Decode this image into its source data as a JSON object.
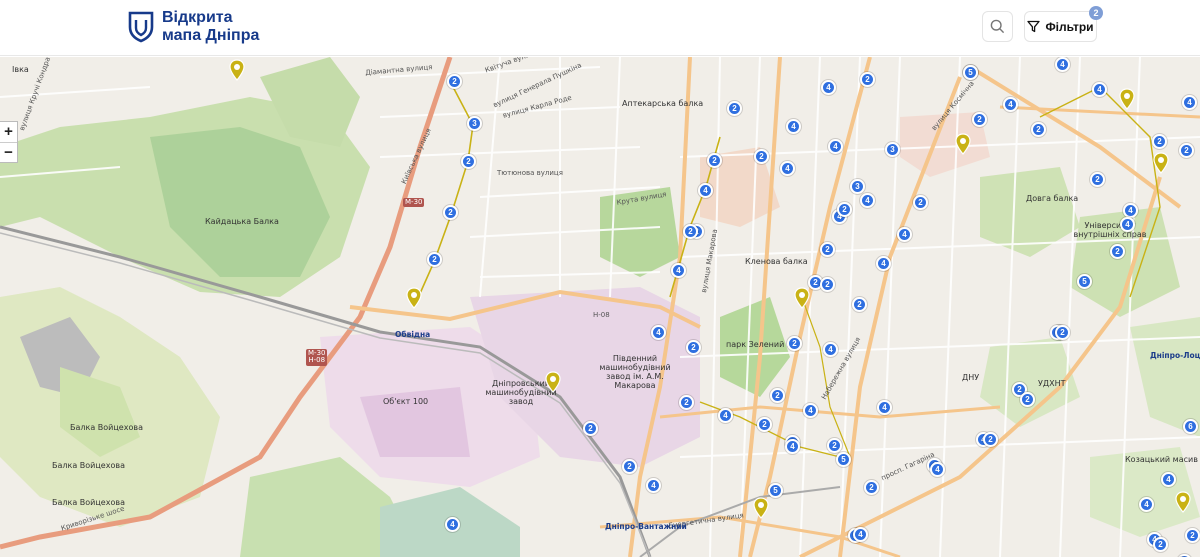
{
  "header": {
    "logo_line1": "Відкрита",
    "logo_line2": "мапа Дніпра",
    "filter_label": "Фільтри",
    "filter_count": "2",
    "accent_color": "#173a8a"
  },
  "zoom": {
    "plus": "+",
    "minus": "−"
  },
  "map_labels": [
    {
      "name": "label-ivka",
      "text": "Івка",
      "cls": ""
    },
    {
      "name": "label-kryvyi-kut",
      "text": "вулиця Кручі Кондратюка",
      "cls": "road"
    },
    {
      "name": "label-diamantna",
      "text": "Діамантна вулиця",
      "cls": "road"
    },
    {
      "name": "label-kvituchasta",
      "text": "Квітуча вулиця",
      "cls": "road"
    },
    {
      "name": "label-karla-rode",
      "text": "вулиця Карла Роде",
      "cls": "road"
    },
    {
      "name": "label-heneral",
      "text": "вулиця Генерала Пушкіна",
      "cls": "road"
    },
    {
      "name": "label-aptekarska",
      "text": "Аптекарська балка",
      "cls": ""
    },
    {
      "name": "label-tiutiunova",
      "text": "Тютюнова вулиця",
      "cls": "road"
    },
    {
      "name": "label-kruta",
      "text": "Крута вулиця",
      "cls": "road"
    },
    {
      "name": "label-kaidatska",
      "text": "Кайдацька Балка",
      "cls": ""
    },
    {
      "name": "label-kyivska",
      "text": "Київська вулиця",
      "cls": "road"
    },
    {
      "name": "label-obidka",
      "text": "Обвідна",
      "cls": "city"
    },
    {
      "name": "label-pivdennyi",
      "text": "Південний машинобудівний завод ім. А.М. Макарова",
      "cls": ""
    },
    {
      "name": "label-dnipro-zavod",
      "text": "Дніпровський машинобудівний завод",
      "cls": ""
    },
    {
      "name": "label-obiekt",
      "text": "Об'єкт 100",
      "cls": ""
    },
    {
      "name": "label-park",
      "text": "парк Зелений Гай",
      "cls": ""
    },
    {
      "name": "label-klenova",
      "text": "Кленова балка",
      "cls": ""
    },
    {
      "name": "label-balka-voitsekhova-1",
      "text": "Балка Войцехова",
      "cls": ""
    },
    {
      "name": "label-balka-voitsekhova-2",
      "text": "Балка Войцехова",
      "cls": ""
    },
    {
      "name": "label-balka-voitsekhova-3",
      "text": "Балка Войцехова",
      "cls": ""
    },
    {
      "name": "label-kryvorizke",
      "text": "Криворізьке шосе",
      "cls": "road"
    },
    {
      "name": "label-energetychna",
      "text": "Енергетична вулиця",
      "cls": "road"
    },
    {
      "name": "label-dnipro-vantazhnyi",
      "text": "Дніпро-Вантажний",
      "cls": "city"
    },
    {
      "name": "label-dnipro-lotsmanska",
      "text": "Дніпро-Лоцманська",
      "cls": "city"
    },
    {
      "name": "label-universytet",
      "text": "Університет внутрішніх справ",
      "cls": ""
    },
    {
      "name": "label-dovha-balka",
      "text": "Довга балка",
      "cls": ""
    },
    {
      "name": "label-udhnt",
      "text": "УДХНТ",
      "cls": ""
    },
    {
      "name": "label-dnu",
      "text": "ДНУ",
      "cls": ""
    },
    {
      "name": "label-kozatska",
      "text": "Козацький масив",
      "cls": ""
    },
    {
      "name": "label-h08-a",
      "text": "Н-08",
      "cls": "road"
    },
    {
      "name": "label-makarova",
      "text": "вулиця Макарова",
      "cls": "road"
    },
    {
      "name": "label-naberezhna",
      "text": "Набережна вулиця",
      "cls": "road"
    },
    {
      "name": "label-ekoloha",
      "text": "вулиця Космічна",
      "cls": "road"
    },
    {
      "name": "label-prospekt",
      "text": "просп. Гагаріна",
      "cls": "road"
    }
  ],
  "route_shields": [
    {
      "name": "shield-m30-top",
      "text": "М-30"
    },
    {
      "name": "shield-m30-h08",
      "text": "М-30\nН-08"
    }
  ],
  "markers": [
    {
      "name": "cluster-marker",
      "label": "2"
    },
    {
      "name": "cluster-marker",
      "label": "3"
    },
    {
      "name": "cluster-marker",
      "label": "2"
    },
    {
      "name": "cluster-marker",
      "label": "2"
    },
    {
      "name": "cluster-marker",
      "label": "2"
    },
    {
      "name": "cluster-marker",
      "label": "4"
    },
    {
      "name": "cluster-marker",
      "label": "2"
    },
    {
      "name": "cluster-marker",
      "label": "4"
    },
    {
      "name": "cluster-marker",
      "label": "4"
    },
    {
      "name": "cluster-marker",
      "label": "4"
    },
    {
      "name": "cluster-marker",
      "label": "4"
    },
    {
      "name": "cluster-marker",
      "label": "4"
    },
    {
      "name": "cluster-marker",
      "label": "2"
    },
    {
      "name": "cluster-marker",
      "label": "4"
    },
    {
      "name": "cluster-marker",
      "label": "2"
    },
    {
      "name": "cluster-marker",
      "label": "2"
    },
    {
      "name": "cluster-marker",
      "label": "4"
    },
    {
      "name": "cluster-marker",
      "label": "4"
    },
    {
      "name": "cluster-marker",
      "label": "5"
    },
    {
      "name": "cluster-marker",
      "label": "4"
    },
    {
      "name": "cluster-marker",
      "label": "2"
    },
    {
      "name": "cluster-marker",
      "label": "3"
    },
    {
      "name": "cluster-marker",
      "label": "4"
    },
    {
      "name": "cluster-marker",
      "label": "4"
    },
    {
      "name": "cluster-marker",
      "label": "3"
    },
    {
      "name": "cluster-marker",
      "label": "2"
    },
    {
      "name": "cluster-marker",
      "label": "2"
    },
    {
      "name": "cluster-marker",
      "label": "2"
    },
    {
      "name": "cluster-marker",
      "label": "2"
    },
    {
      "name": "cluster-marker",
      "label": "2"
    },
    {
      "name": "cluster-marker",
      "label": "2"
    },
    {
      "name": "cluster-marker",
      "label": "4"
    },
    {
      "name": "cluster-marker",
      "label": "2"
    },
    {
      "name": "cluster-marker",
      "label": "2"
    },
    {
      "name": "cluster-marker",
      "label": "4"
    },
    {
      "name": "cluster-marker",
      "label": "5"
    },
    {
      "name": "cluster-marker",
      "label": "2"
    },
    {
      "name": "cluster-marker",
      "label": "4"
    },
    {
      "name": "cluster-marker",
      "label": "2"
    },
    {
      "name": "cluster-marker",
      "label": "2"
    },
    {
      "name": "cluster-marker",
      "label": "4"
    },
    {
      "name": "cluster-marker",
      "label": "4"
    },
    {
      "name": "cluster-marker",
      "label": "2"
    },
    {
      "name": "cluster-marker",
      "label": "4"
    },
    {
      "name": "cluster-marker",
      "label": "4"
    },
    {
      "name": "cluster-marker",
      "label": "2"
    },
    {
      "name": "cluster-marker",
      "label": "4"
    },
    {
      "name": "cluster-marker",
      "label": "6"
    },
    {
      "name": "cluster-marker",
      "label": "2"
    },
    {
      "name": "cluster-marker",
      "label": "4"
    },
    {
      "name": "cluster-marker",
      "label": "2"
    },
    {
      "name": "cluster-marker",
      "label": "2"
    },
    {
      "name": "cluster-marker",
      "label": "4"
    },
    {
      "name": "cluster-marker",
      "label": "2"
    },
    {
      "name": "cluster-marker",
      "label": "5"
    },
    {
      "name": "cluster-marker",
      "label": "4"
    },
    {
      "name": "cluster-marker",
      "label": "2"
    },
    {
      "name": "cluster-marker",
      "label": "2"
    },
    {
      "name": "cluster-marker",
      "label": "4"
    },
    {
      "name": "cluster-marker",
      "label": "4"
    },
    {
      "name": "cluster-marker",
      "label": "2"
    },
    {
      "name": "cluster-marker",
      "label": "4"
    },
    {
      "name": "cluster-marker",
      "label": "4"
    },
    {
      "name": "cluster-marker",
      "label": "2"
    },
    {
      "name": "cluster-marker",
      "label": "4"
    },
    {
      "name": "cluster-marker",
      "label": "2"
    },
    {
      "name": "cluster-marker",
      "label": "4"
    },
    {
      "name": "cluster-marker",
      "label": "4"
    },
    {
      "name": "cluster-marker",
      "label": "2"
    },
    {
      "name": "cluster-marker",
      "label": "2"
    },
    {
      "name": "cluster-marker",
      "label": "4"
    },
    {
      "name": "cluster-marker",
      "label": "4"
    },
    {
      "name": "cluster-marker",
      "label": "5"
    },
    {
      "name": "cluster-marker",
      "label": "4"
    },
    {
      "name": "cluster-marker",
      "label": "2"
    },
    {
      "name": "cluster-marker",
      "label": "2"
    },
    {
      "name": "cluster-marker",
      "label": "2"
    },
    {
      "name": "cluster-marker",
      "label": "4"
    },
    {
      "name": "cluster-marker",
      "label": "2"
    },
    {
      "name": "cluster-marker",
      "label": "4"
    },
    {
      "name": "cluster-marker",
      "label": "4"
    },
    {
      "name": "cluster-marker",
      "label": "2"
    },
    {
      "name": "cluster-marker",
      "label": "2"
    }
  ],
  "pin_color": "#c9b215",
  "marker_color": "#2f6fe0"
}
